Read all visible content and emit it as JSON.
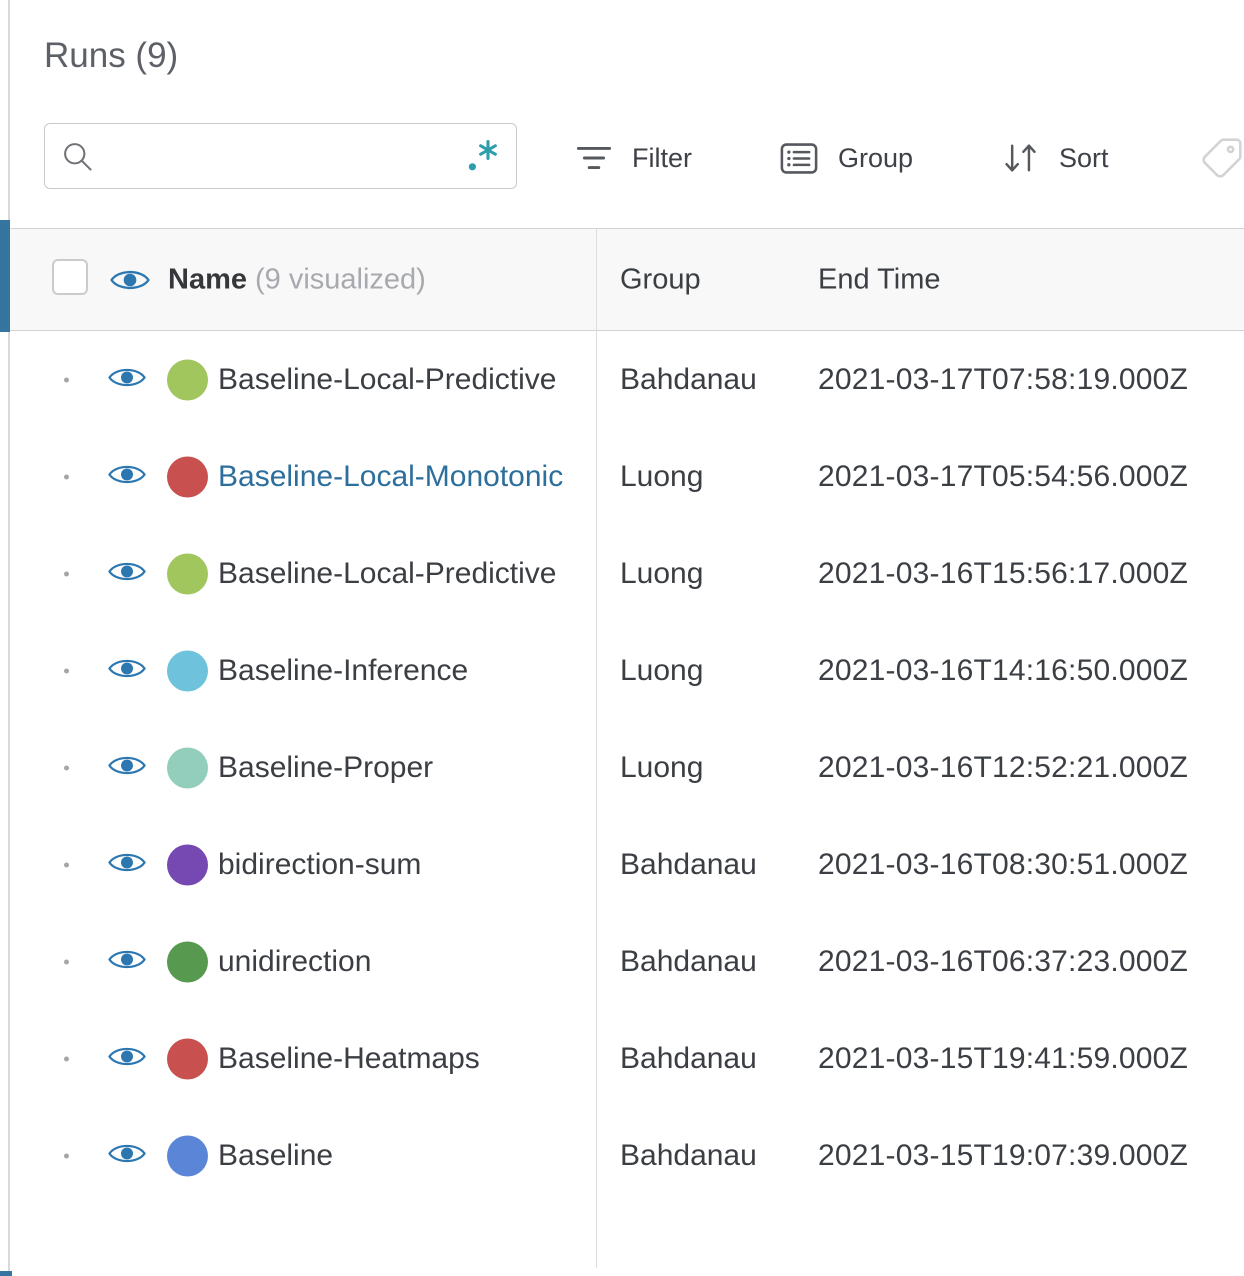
{
  "panel": {
    "title": "Runs (9)",
    "search": {
      "value": ""
    },
    "toolbar": {
      "filter_label": "Filter",
      "group_label": "Group",
      "sort_label": "Sort"
    }
  },
  "table": {
    "header": {
      "name_label": "Name",
      "visualized_label": "(9 visualized)",
      "group_label": "Group",
      "end_time_label": "End Time"
    },
    "rows": [
      {
        "name": "Baseline-Local-Predictive",
        "color": "#a2c65e",
        "group": "Bahdanau",
        "end_time": "2021-03-17T07:58:19.000Z",
        "link": false
      },
      {
        "name": "Baseline-Local-Monotonic",
        "color": "#c8504f",
        "group": "Luong",
        "end_time": "2021-03-17T05:54:56.000Z",
        "link": true
      },
      {
        "name": "Baseline-Local-Predictive",
        "color": "#a2c65e",
        "group": "Luong",
        "end_time": "2021-03-16T15:56:17.000Z",
        "link": false
      },
      {
        "name": "Baseline-Inference",
        "color": "#6ec2dc",
        "group": "Luong",
        "end_time": "2021-03-16T14:16:50.000Z",
        "link": false
      },
      {
        "name": "Baseline-Proper",
        "color": "#92cebb",
        "group": "Luong",
        "end_time": "2021-03-16T12:52:21.000Z",
        "link": false
      },
      {
        "name": "bidirection-sum",
        "color": "#7649b2",
        "group": "Bahdanau",
        "end_time": "2021-03-16T08:30:51.000Z",
        "link": false
      },
      {
        "name": "unidirection",
        "color": "#56994f",
        "group": "Bahdanau",
        "end_time": "2021-03-16T06:37:23.000Z",
        "link": false
      },
      {
        "name": "Baseline-Heatmaps",
        "color": "#c8504f",
        "group": "Bahdanau",
        "end_time": "2021-03-15T19:41:59.000Z",
        "link": false
      },
      {
        "name": "Baseline",
        "color": "#5b86d7",
        "group": "Bahdanau",
        "end_time": "2021-03-15T19:07:39.000Z",
        "link": false
      }
    ]
  },
  "colors": {
    "eye_blue": "#2d77b0",
    "link_blue": "#2c6e9c",
    "header_bar_blue": "#35749f",
    "regex_teal": "#2f9eab"
  }
}
